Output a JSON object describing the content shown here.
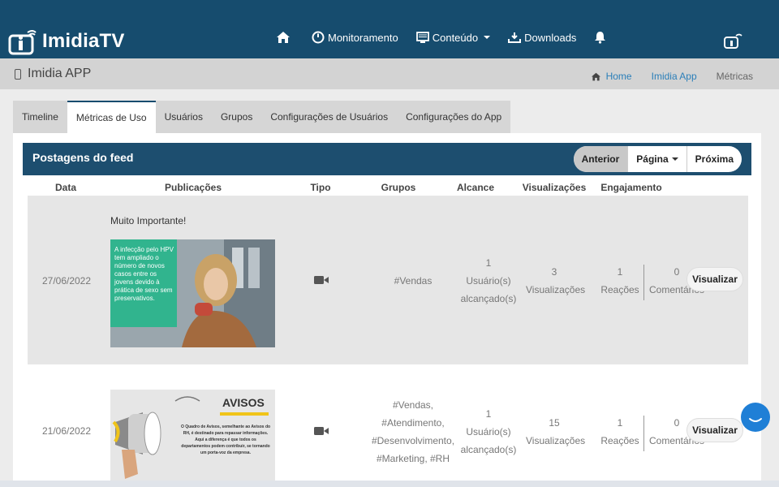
{
  "brand": {
    "name": "ImidiaTV",
    "color": "#164c6e"
  },
  "nav": {
    "items": [
      {
        "label": "",
        "icon": "home-icon"
      },
      {
        "label": "Monitoramento",
        "icon": "gauge-icon"
      },
      {
        "label": "Conteúdo",
        "icon": "monitor-icon",
        "dropdown": true
      },
      {
        "label": "Downloads",
        "icon": "download-icon"
      },
      {
        "label": "",
        "icon": "bell-icon"
      }
    ]
  },
  "subheader": {
    "title": "Imidia APP",
    "breadcrumb": [
      "Home",
      "Imidia App",
      "Métricas"
    ]
  },
  "tabs": [
    "Timeline",
    "Métricas de Uso",
    "Usuários",
    "Grupos",
    "Configurações de Usuários",
    "Configurações do App"
  ],
  "active_tab": "Métricas de Uso",
  "card": {
    "title": "Postagens do feed",
    "pager": {
      "prev": "Anterior",
      "page": "Página",
      "next": "Próxima"
    }
  },
  "table": {
    "columns": [
      "Data",
      "Publicações",
      "Tipo",
      "Grupos",
      "Alcance",
      "Visualizações",
      "Engajamento"
    ],
    "rows": [
      {
        "date": "27/06/2022",
        "text": "Muito Importante!",
        "thumb_caption": "A infecção pelo HPV tem ampliado o número de novos casos entre os jovens devido à prática de sexo sem preservativos.",
        "groups": "#Vendas",
        "reach": [
          "1",
          "Usuário(s)",
          "alcançado(s)"
        ],
        "views": [
          "3",
          "Visualizações"
        ],
        "reactions": [
          "1",
          "Reações"
        ],
        "comments": [
          "0",
          "Comentários"
        ],
        "action": "Visualizar"
      },
      {
        "date": "21/06/2022",
        "text": "",
        "thumb_title": "AVISOS",
        "thumb_caption": "O Quadro de Avisos, semelhante ao Avisos do RH, é destinado para repassar informações. Aqui a diferença é que todos os departamentos podem contribuir, se tornando um porta-voz da empresa.",
        "groups": [
          "#Vendas,",
          "#Atendimento,",
          "#Desenvolvimento,",
          "#Marketing, #RH"
        ],
        "reach": [
          "1",
          "Usuário(s)",
          "alcançado(s)"
        ],
        "views": [
          "15",
          "Visualizações"
        ],
        "reactions": [
          "1",
          "Reações"
        ],
        "comments": [
          "0",
          "Comentários"
        ],
        "action": "Visualizar"
      }
    ]
  }
}
